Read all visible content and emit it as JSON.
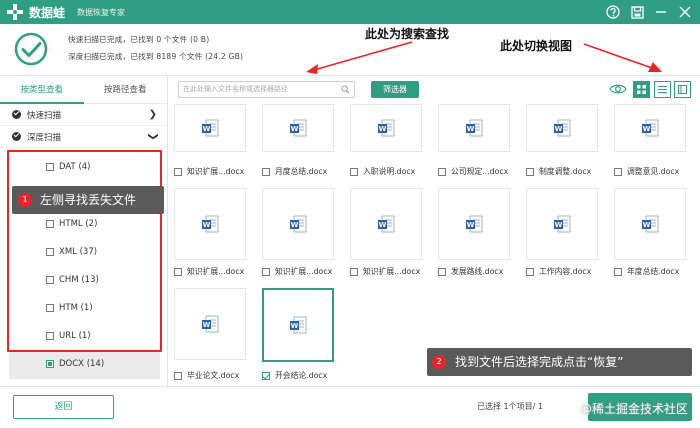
{
  "app": {
    "name": "数据蛙",
    "subtitle": "数据恢复专家"
  },
  "header": {
    "quick_scan_text": "快速扫描已完成，已找到 0 个文件 (0 B)",
    "deep_scan_text": "深度扫描已完成，已找到 8189 个文件 (24.2 GB)"
  },
  "annotations": {
    "search_hint": "此处为搜索查找",
    "view_hint": "此处切换视图"
  },
  "sidebar": {
    "tabs": [
      {
        "label": "按类型查看"
      },
      {
        "label": "按路径查看"
      }
    ],
    "scans": [
      {
        "label": "快速扫描"
      },
      {
        "label": "深度扫描"
      }
    ],
    "types": [
      {
        "label": "DAT (4)"
      },
      {
        "label": "HTML (2)"
      },
      {
        "label": "XML (37)"
      },
      {
        "label": "CHM (13)"
      },
      {
        "label": "HTM (1)"
      },
      {
        "label": "URL (1)"
      },
      {
        "label": "DOCX (14)"
      }
    ]
  },
  "tooltips": {
    "left": {
      "num": "1",
      "text": "左侧寻找丢失文件"
    },
    "right": {
      "num": "2",
      "text": "找到文件后选择完成点击“恢复”"
    }
  },
  "toolbar": {
    "search_placeholder": "在此处输入文件名称或选择器路径",
    "filter_label": "筛选器"
  },
  "files": [
    {
      "name": "知识扩展...docx"
    },
    {
      "name": "月度总结.docx"
    },
    {
      "name": "入职说明.docx"
    },
    {
      "name": "公司规定...docx"
    },
    {
      "name": "制度调整.docx"
    },
    {
      "name": "调整意见.docx"
    },
    {
      "name": "知识扩展...docx"
    },
    {
      "name": "知识扩展...docx"
    },
    {
      "name": "知识扩展...docx"
    },
    {
      "name": "发展路线.docx"
    },
    {
      "name": "工作内容.docx"
    },
    {
      "name": "年度总结.docx"
    },
    {
      "name": "毕业论文.docx"
    },
    {
      "name": "开会结论.docx"
    }
  ],
  "footer": {
    "back_label": "返回",
    "selection_text": "已选择 1个项目/ 1"
  },
  "watermark": "@稀土掘金技术社区"
}
